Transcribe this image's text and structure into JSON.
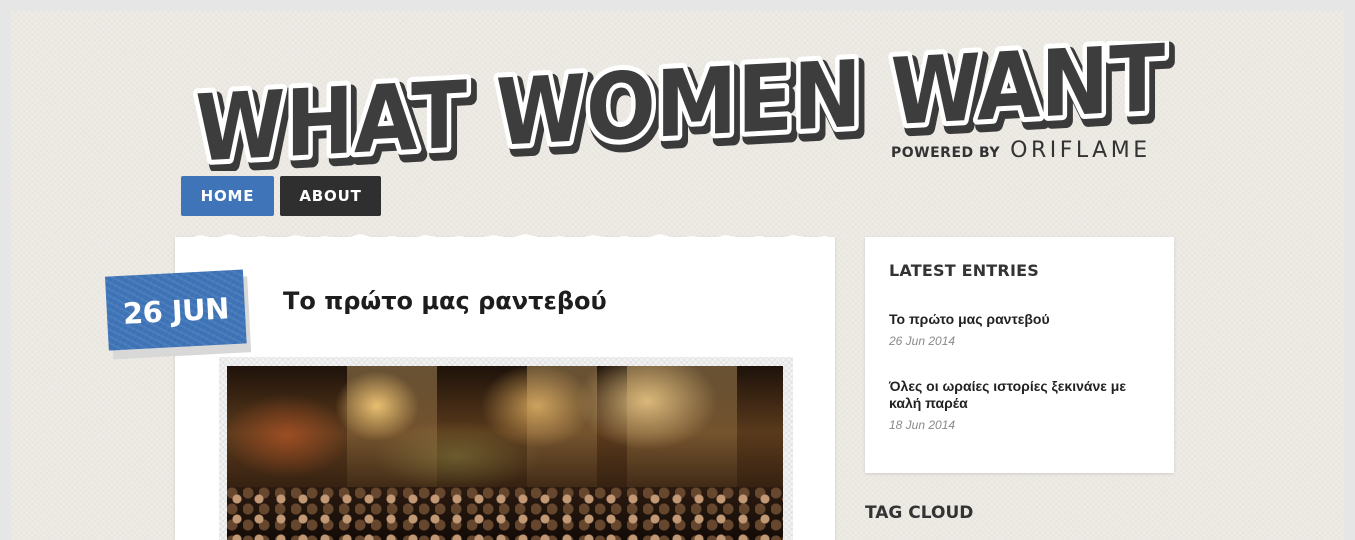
{
  "header": {
    "logo_text": "WHAT WOMEN WANT",
    "powered_by": "POWERED BY",
    "brand": "ORIFLAME"
  },
  "nav": {
    "items": [
      {
        "label": "HOME",
        "active": true
      },
      {
        "label": "ABOUT",
        "active": false
      }
    ]
  },
  "post": {
    "date": "26 JUN",
    "title": "Το πρώτο μας ραντεβού"
  },
  "sidebar": {
    "latest_title": "LATEST ENTRIES",
    "entries": [
      {
        "title": "Το πρώτο μας ραντεβού",
        "date": "26 Jun 2014"
      },
      {
        "title": "Όλες οι ωραίες ιστορίες ξεκινάνε με καλή παρέα",
        "date": "18 Jun 2014"
      }
    ],
    "tag_cloud_title": "TAG CLOUD"
  },
  "colors": {
    "accent_blue": "#3f75b8",
    "nav_dark": "#2f2f2f",
    "background": "#eeebe5"
  }
}
